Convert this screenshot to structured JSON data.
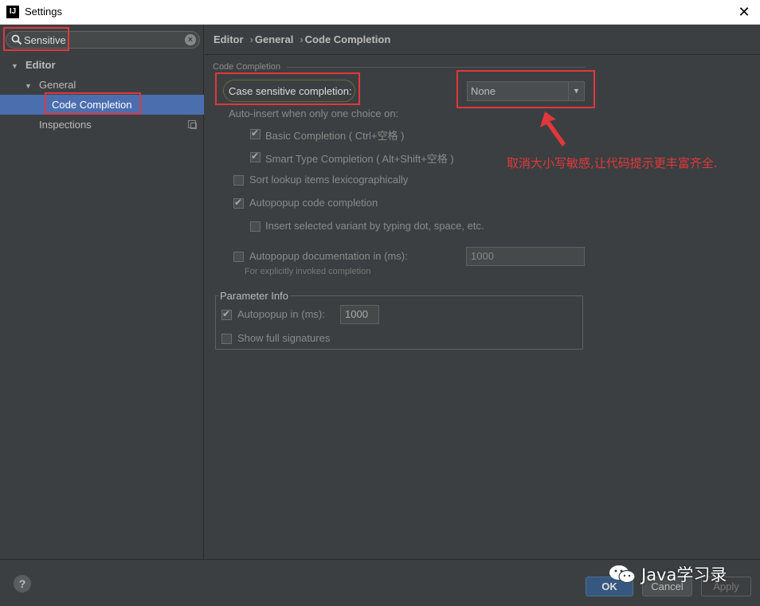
{
  "window": {
    "title": "Settings",
    "app_icon": "IJ"
  },
  "sidebar": {
    "search_value": "Sensitive",
    "tree": [
      {
        "label": "Editor",
        "expanded": true
      },
      {
        "label": "General",
        "expanded": true
      },
      {
        "label": "Code Completion",
        "selected": true
      },
      {
        "label": "Inspections"
      }
    ]
  },
  "breadcrumb": [
    "Editor",
    "General",
    "Code Completion"
  ],
  "content": {
    "section_title": "Code Completion",
    "case_sensitive_label": "Case sensitive completion:",
    "case_sensitive_value": "None",
    "auto_insert_label": "Auto-insert when only one choice on:",
    "basic_completion": "Basic Completion ( Ctrl+空格 )",
    "smart_completion": "Smart Type Completion ( Alt+Shift+空格 )",
    "sort_lexi": "Sort lookup items lexicographically",
    "autopopup_code": "Autopopup code completion",
    "insert_variant": "Insert selected variant by typing dot, space, etc.",
    "autopopup_doc": "Autopopup documentation in (ms):",
    "autopopup_doc_value": "1000",
    "autopopup_doc_hint": "For explicitly invoked completion",
    "param_info_title": "Parameter Info",
    "param_autopopup": "Autopopup in (ms):",
    "param_autopopup_value": "1000",
    "show_full_signatures": "Show full signatures"
  },
  "annotation": "取消大小写敏感,让代码提示更丰富齐全.",
  "footer": {
    "help": "?",
    "ok": "OK",
    "cancel": "Cancel",
    "apply": "Apply"
  },
  "watermark": "Java学习录",
  "colors": {
    "background": "#3c3f41",
    "selection": "#4b6eaf",
    "highlight_red": "#e0383c",
    "ok_button": "#365880"
  }
}
